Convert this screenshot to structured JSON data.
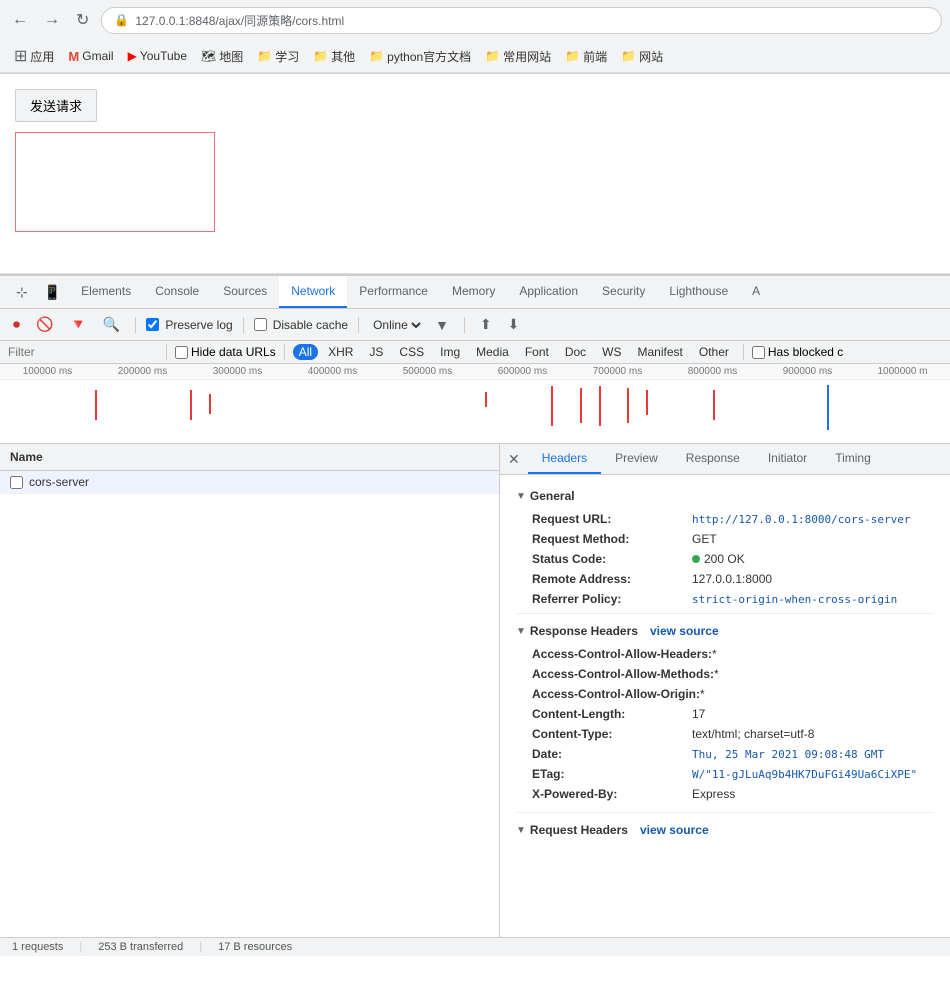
{
  "browser": {
    "url": "127.0.0.1:8848/ajax/同源策略/cors.html",
    "back_icon": "←",
    "forward_icon": "→",
    "reload_icon": "↻"
  },
  "bookmarks": [
    {
      "icon": "⊞",
      "label": "应用",
      "type": "apps"
    },
    {
      "icon": "M",
      "label": "Gmail",
      "color": "#EA4335"
    },
    {
      "icon": "▶",
      "label": "YouTube",
      "color": "#FF0000"
    },
    {
      "icon": "🗺",
      "label": "地图"
    },
    {
      "icon": "📁",
      "label": "学习"
    },
    {
      "icon": "📁",
      "label": "其他"
    },
    {
      "icon": "📁",
      "label": "python官方文档"
    },
    {
      "icon": "📁",
      "label": "常用网站"
    },
    {
      "icon": "📁",
      "label": "前端"
    },
    {
      "icon": "📁",
      "label": "网站"
    }
  ],
  "page": {
    "send_button_label": "发送请求"
  },
  "devtools": {
    "tabs": [
      "Elements",
      "Console",
      "Sources",
      "Network",
      "Performance",
      "Memory",
      "Application",
      "Security",
      "Lighthouse",
      "A"
    ],
    "active_tab": "Network",
    "toolbar": {
      "filter_placeholder": "Filter",
      "preserve_cache_label": "Preserve log",
      "disable_cache_label": "Disable cache",
      "online_label": "Online"
    },
    "filter_tags": [
      "All",
      "XHR",
      "JS",
      "CSS",
      "Img",
      "Media",
      "Font",
      "Doc",
      "WS",
      "Manifest",
      "Other"
    ],
    "active_filter": "All",
    "hide_data_urls": "Hide data URLs",
    "has_blocked": "Has blocked c",
    "timeline_labels": [
      "100000 ms",
      "200000 ms",
      "300000 ms",
      "400000 ms",
      "500000 ms",
      "600000 ms",
      "700000 ms",
      "800000 ms",
      "900000 ms",
      "1000000 m"
    ],
    "table": {
      "name_col": "Name",
      "rows": [
        {
          "name": "cors-server"
        }
      ]
    },
    "detail": {
      "tabs": [
        "Headers",
        "Preview",
        "Response",
        "Initiator",
        "Timing"
      ],
      "active_tab": "Headers",
      "general_section": "General",
      "request_url_label": "Request URL:",
      "request_url_value": "http://127.0.0.1:8000/cors-server",
      "request_method_label": "Request Method:",
      "request_method_value": "GET",
      "status_code_label": "Status Code:",
      "status_code_value": "200 OK",
      "remote_address_label": "Remote Address:",
      "remote_address_value": "127.0.0.1:8000",
      "referrer_policy_label": "Referrer Policy:",
      "referrer_policy_value": "strict-origin-when-cross-origin",
      "response_headers_section": "Response Headers",
      "view_source_label": "view source",
      "response_headers": [
        {
          "key": "Access-Control-Allow-Headers:",
          "value": "*"
        },
        {
          "key": "Access-Control-Allow-Methods:",
          "value": "*"
        },
        {
          "key": "Access-Control-Allow-Origin:",
          "value": "*"
        },
        {
          "key": "Content-Length:",
          "value": "17"
        },
        {
          "key": "Content-Type:",
          "value": "text/html; charset=utf-8"
        },
        {
          "key": "Date:",
          "value": "Thu, 25 Mar 2021 09:08:48 GMT"
        },
        {
          "key": "ETag:",
          "value": "W/\"11-gJLuAq9b4HK7DuFGi49Ua6CiXPE\""
        },
        {
          "key": "X-Powered-By:",
          "value": "Express"
        }
      ],
      "request_headers_section": "Request Headers",
      "request_view_source_label": "view source"
    },
    "status_bar": {
      "requests": "1 requests",
      "transferred": "253 B transferred",
      "resources": "17 B resources"
    }
  }
}
